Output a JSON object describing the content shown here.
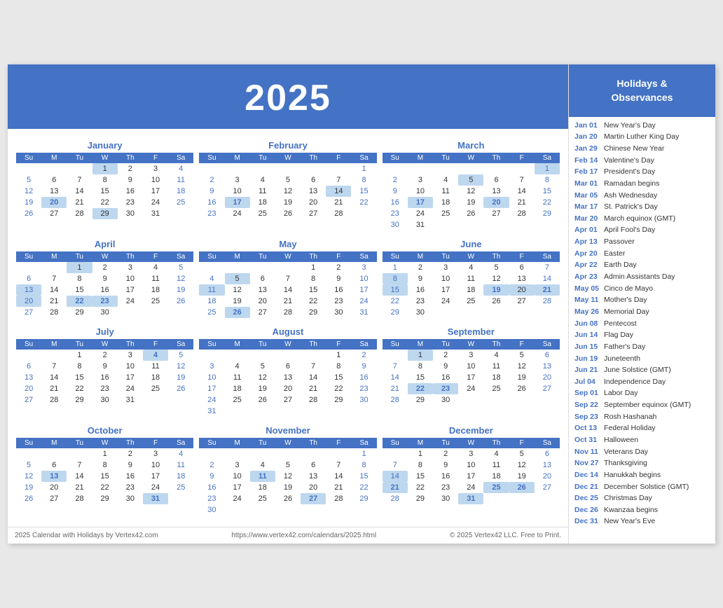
{
  "year": "2025",
  "footer": {
    "left": "2025 Calendar with Holidays by Vertex42.com",
    "center": "https://www.vertex42.com/calendars/2025.html",
    "right": "© 2025 Vertex42 LLC. Free to Print."
  },
  "holidays_header": "Holidays &\nObservances",
  "holidays": [
    {
      "date": "Jan 01",
      "name": "New Year's Day"
    },
    {
      "date": "Jan 20",
      "name": "Martin Luther King Day"
    },
    {
      "date": "Jan 29",
      "name": "Chinese New Year"
    },
    {
      "date": "Feb 14",
      "name": "Valentine's Day"
    },
    {
      "date": "Feb 17",
      "name": "President's Day"
    },
    {
      "date": "Mar 01",
      "name": "Ramadan begins"
    },
    {
      "date": "Mar 05",
      "name": "Ash Wednesday"
    },
    {
      "date": "Mar 17",
      "name": "St. Patrick's Day"
    },
    {
      "date": "Mar 20",
      "name": "March equinox (GMT)"
    },
    {
      "date": "Apr 01",
      "name": "April Fool's Day"
    },
    {
      "date": "Apr 13",
      "name": "Passover"
    },
    {
      "date": "Apr 20",
      "name": "Easter"
    },
    {
      "date": "Apr 22",
      "name": "Earth Day"
    },
    {
      "date": "Apr 23",
      "name": "Admin Assistants Day"
    },
    {
      "date": "May 05",
      "name": "Cinco de Mayo"
    },
    {
      "date": "May 11",
      "name": "Mother's Day"
    },
    {
      "date": "May 26",
      "name": "Memorial Day"
    },
    {
      "date": "Jun 08",
      "name": "Pentecost"
    },
    {
      "date": "Jun 14",
      "name": "Flag Day"
    },
    {
      "date": "Jun 15",
      "name": "Father's Day"
    },
    {
      "date": "Jun 19",
      "name": "Juneteenth"
    },
    {
      "date": "Jun 21",
      "name": "June Solstice (GMT)"
    },
    {
      "date": "Jul 04",
      "name": "Independence Day"
    },
    {
      "date": "Sep 01",
      "name": "Labor Day"
    },
    {
      "date": "Sep 22",
      "name": "September equinox (GMT)"
    },
    {
      "date": "Sep 23",
      "name": "Rosh Hashanah"
    },
    {
      "date": "Oct 13",
      "name": "Federal Holiday"
    },
    {
      "date": "Oct 31",
      "name": "Halloween"
    },
    {
      "date": "Nov 11",
      "name": "Veterans Day"
    },
    {
      "date": "Nov 27",
      "name": "Thanksgiving"
    },
    {
      "date": "Dec 14",
      "name": "Hanukkah begins"
    },
    {
      "date": "Dec 21",
      "name": "December Solstice (GMT)"
    },
    {
      "date": "Dec 25",
      "name": "Christmas Day"
    },
    {
      "date": "Dec 26",
      "name": "Kwanzaa begins"
    },
    {
      "date": "Dec 31",
      "name": "New Year's Eve"
    }
  ],
  "months": [
    {
      "name": "January",
      "weeks": [
        [
          null,
          null,
          null,
          1,
          2,
          3,
          4
        ],
        [
          5,
          6,
          7,
          8,
          9,
          10,
          11
        ],
        [
          12,
          13,
          14,
          15,
          16,
          17,
          18
        ],
        [
          19,
          20,
          21,
          22,
          23,
          24,
          25
        ],
        [
          26,
          27,
          28,
          29,
          30,
          31,
          null
        ]
      ],
      "highlighted": [
        1,
        20,
        29
      ],
      "bold_blue": [
        20
      ]
    },
    {
      "name": "February",
      "weeks": [
        [
          null,
          null,
          null,
          null,
          null,
          null,
          1
        ],
        [
          2,
          3,
          4,
          5,
          6,
          7,
          8
        ],
        [
          9,
          10,
          11,
          12,
          13,
          14,
          15
        ],
        [
          16,
          17,
          18,
          19,
          20,
          21,
          22
        ],
        [
          23,
          24,
          25,
          26,
          27,
          28,
          null
        ]
      ],
      "highlighted": [
        14,
        17
      ],
      "bold_blue": [
        17
      ]
    },
    {
      "name": "March",
      "weeks": [
        [
          null,
          null,
          null,
          null,
          null,
          null,
          1
        ],
        [
          2,
          3,
          4,
          5,
          6,
          7,
          8
        ],
        [
          9,
          10,
          11,
          12,
          13,
          14,
          15
        ],
        [
          16,
          17,
          18,
          19,
          20,
          21,
          22
        ],
        [
          23,
          24,
          25,
          26,
          27,
          28,
          29
        ],
        [
          30,
          31,
          null,
          null,
          null,
          null,
          null
        ]
      ],
      "highlighted": [
        1,
        5,
        17,
        20
      ],
      "bold_blue": [
        17,
        20
      ]
    },
    {
      "name": "April",
      "weeks": [
        [
          null,
          null,
          1,
          2,
          3,
          4,
          5
        ],
        [
          6,
          7,
          8,
          9,
          10,
          11,
          12
        ],
        [
          13,
          14,
          15,
          16,
          17,
          18,
          19
        ],
        [
          20,
          21,
          22,
          23,
          24,
          25,
          26
        ],
        [
          27,
          28,
          29,
          30,
          null,
          null,
          null
        ]
      ],
      "highlighted": [
        1,
        13,
        20,
        22,
        23
      ],
      "bold_blue": [
        22,
        23
      ]
    },
    {
      "name": "May",
      "weeks": [
        [
          null,
          null,
          null,
          null,
          1,
          2,
          3
        ],
        [
          4,
          5,
          6,
          7,
          8,
          9,
          10
        ],
        [
          11,
          12,
          13,
          14,
          15,
          16,
          17
        ],
        [
          18,
          19,
          20,
          21,
          22,
          23,
          24
        ],
        [
          25,
          26,
          27,
          28,
          29,
          30,
          31
        ]
      ],
      "highlighted": [
        5,
        11,
        26
      ],
      "bold_blue": [
        26
      ]
    },
    {
      "name": "June",
      "weeks": [
        [
          1,
          2,
          3,
          4,
          5,
          6,
          7
        ],
        [
          8,
          9,
          10,
          11,
          12,
          13,
          14
        ],
        [
          15,
          16,
          17,
          18,
          19,
          20,
          21
        ],
        [
          22,
          23,
          24,
          25,
          26,
          27,
          28
        ],
        [
          29,
          30,
          null,
          null,
          null,
          null,
          null
        ]
      ],
      "highlighted": [
        8,
        15,
        19,
        20,
        21
      ],
      "bold_blue": [
        19,
        21
      ]
    },
    {
      "name": "July",
      "weeks": [
        [
          null,
          null,
          1,
          2,
          3,
          4,
          5
        ],
        [
          6,
          7,
          8,
          9,
          10,
          11,
          12
        ],
        [
          13,
          14,
          15,
          16,
          17,
          18,
          19
        ],
        [
          20,
          21,
          22,
          23,
          24,
          25,
          26
        ],
        [
          27,
          28,
          29,
          30,
          31,
          null,
          null
        ]
      ],
      "highlighted": [
        4
      ],
      "bold_blue": [
        4
      ]
    },
    {
      "name": "August",
      "weeks": [
        [
          null,
          null,
          null,
          null,
          null,
          1,
          2
        ],
        [
          3,
          4,
          5,
          6,
          7,
          8,
          9
        ],
        [
          10,
          11,
          12,
          13,
          14,
          15,
          16
        ],
        [
          17,
          18,
          19,
          20,
          21,
          22,
          23
        ],
        [
          24,
          25,
          26,
          27,
          28,
          29,
          30
        ],
        [
          31,
          null,
          null,
          null,
          null,
          null,
          null
        ]
      ],
      "highlighted": [],
      "bold_blue": []
    },
    {
      "name": "September",
      "weeks": [
        [
          null,
          1,
          2,
          3,
          4,
          5,
          6
        ],
        [
          7,
          8,
          9,
          10,
          11,
          12,
          13
        ],
        [
          14,
          15,
          16,
          17,
          18,
          19,
          20
        ],
        [
          21,
          22,
          23,
          24,
          25,
          26,
          27
        ],
        [
          28,
          29,
          30,
          null,
          null,
          null,
          null
        ]
      ],
      "highlighted": [
        1,
        22,
        23
      ],
      "bold_blue": [
        22,
        23
      ]
    },
    {
      "name": "October",
      "weeks": [
        [
          null,
          null,
          null,
          1,
          2,
          3,
          4
        ],
        [
          5,
          6,
          7,
          8,
          9,
          10,
          11
        ],
        [
          12,
          13,
          14,
          15,
          16,
          17,
          18
        ],
        [
          19,
          20,
          21,
          22,
          23,
          24,
          25
        ],
        [
          26,
          27,
          28,
          29,
          30,
          31,
          null
        ]
      ],
      "highlighted": [
        13,
        31
      ],
      "bold_blue": [
        13,
        31
      ]
    },
    {
      "name": "November",
      "weeks": [
        [
          null,
          null,
          null,
          null,
          null,
          null,
          1
        ],
        [
          2,
          3,
          4,
          5,
          6,
          7,
          8
        ],
        [
          9,
          10,
          11,
          12,
          13,
          14,
          15
        ],
        [
          16,
          17,
          18,
          19,
          20,
          21,
          22
        ],
        [
          23,
          24,
          25,
          26,
          27,
          28,
          29
        ],
        [
          30,
          null,
          null,
          null,
          null,
          null,
          null
        ]
      ],
      "highlighted": [
        11,
        27
      ],
      "bold_blue": [
        11,
        27
      ]
    },
    {
      "name": "December",
      "weeks": [
        [
          null,
          1,
          2,
          3,
          4,
          5,
          6
        ],
        [
          7,
          8,
          9,
          10,
          11,
          12,
          13
        ],
        [
          14,
          15,
          16,
          17,
          18,
          19,
          20
        ],
        [
          21,
          22,
          23,
          24,
          25,
          26,
          27
        ],
        [
          28,
          29,
          30,
          31,
          null,
          null,
          null
        ]
      ],
      "highlighted": [
        14,
        21,
        25,
        26,
        31
      ],
      "bold_blue": [
        21,
        25,
        26,
        31
      ]
    }
  ]
}
